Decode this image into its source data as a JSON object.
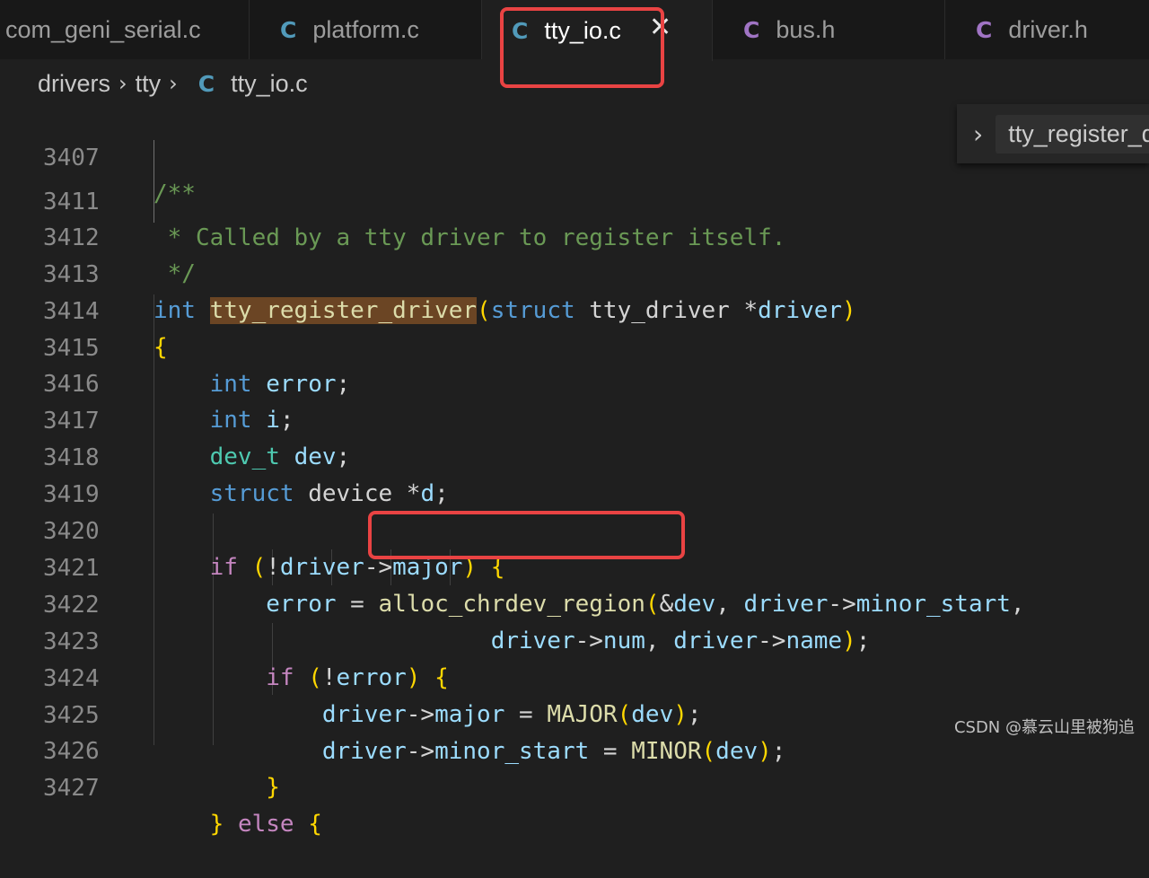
{
  "tabs": [
    {
      "label": "com_geni_serial.c",
      "icon": "c-file-icon",
      "icon_text": ""
    },
    {
      "label": "platform.c",
      "icon": "c-file-icon",
      "icon_text": "C"
    },
    {
      "label": "tty_io.c",
      "icon": "c-file-icon",
      "icon_text": "C",
      "active": true,
      "close_glyph": "✕"
    },
    {
      "label": "bus.h",
      "icon": "c-header-icon",
      "icon_text": "C"
    },
    {
      "label": "driver.h",
      "icon": "c-header-icon",
      "icon_text": "C"
    }
  ],
  "breadcrumb": {
    "parts": [
      "drivers",
      "tty"
    ],
    "separator": "›",
    "file_icon_text": "C",
    "file": "tty_io.c"
  },
  "sticky_scroll": {
    "chevron": "›",
    "symbol": "tty_register_d"
  },
  "lines": [
    {
      "num": "3407",
      "text": "/**"
    },
    {
      "num": "3411",
      "text": " * Called by a tty driver to register itself."
    },
    {
      "num": "3412",
      "text": " */"
    },
    {
      "num": "3413",
      "text": "int tty_register_driver(struct tty_driver *driver)"
    },
    {
      "num": "3414",
      "text": "{"
    },
    {
      "num": "3415",
      "text": "    int error;"
    },
    {
      "num": "3416",
      "text": "    int i;"
    },
    {
      "num": "3417",
      "text": "    dev_t dev;"
    },
    {
      "num": "3418",
      "text": "    struct device *d;"
    },
    {
      "num": "3419",
      "text": ""
    },
    {
      "num": "3420",
      "text": "    if (!driver->major) {"
    },
    {
      "num": "3421",
      "text": "        error = alloc_chrdev_region(&dev, driver->minor_start,"
    },
    {
      "num": "3422",
      "text": "                        driver->num, driver->name);"
    },
    {
      "num": "3423",
      "text": "        if (!error) {"
    },
    {
      "num": "3424",
      "text": "            driver->major = MAJOR(dev);"
    },
    {
      "num": "3425",
      "text": "            driver->minor_start = MINOR(dev);"
    },
    {
      "num": "3426",
      "text": "        }"
    },
    {
      "num": "3427",
      "text": "    } else {"
    }
  ],
  "watermark": "CSDN @慕云山里被狗追",
  "colors": {
    "accent_red": "#e94343",
    "comment": "#6a9955",
    "keyword": "#569cd6",
    "function": "#dcdcaa",
    "variable": "#9cdcfe"
  }
}
